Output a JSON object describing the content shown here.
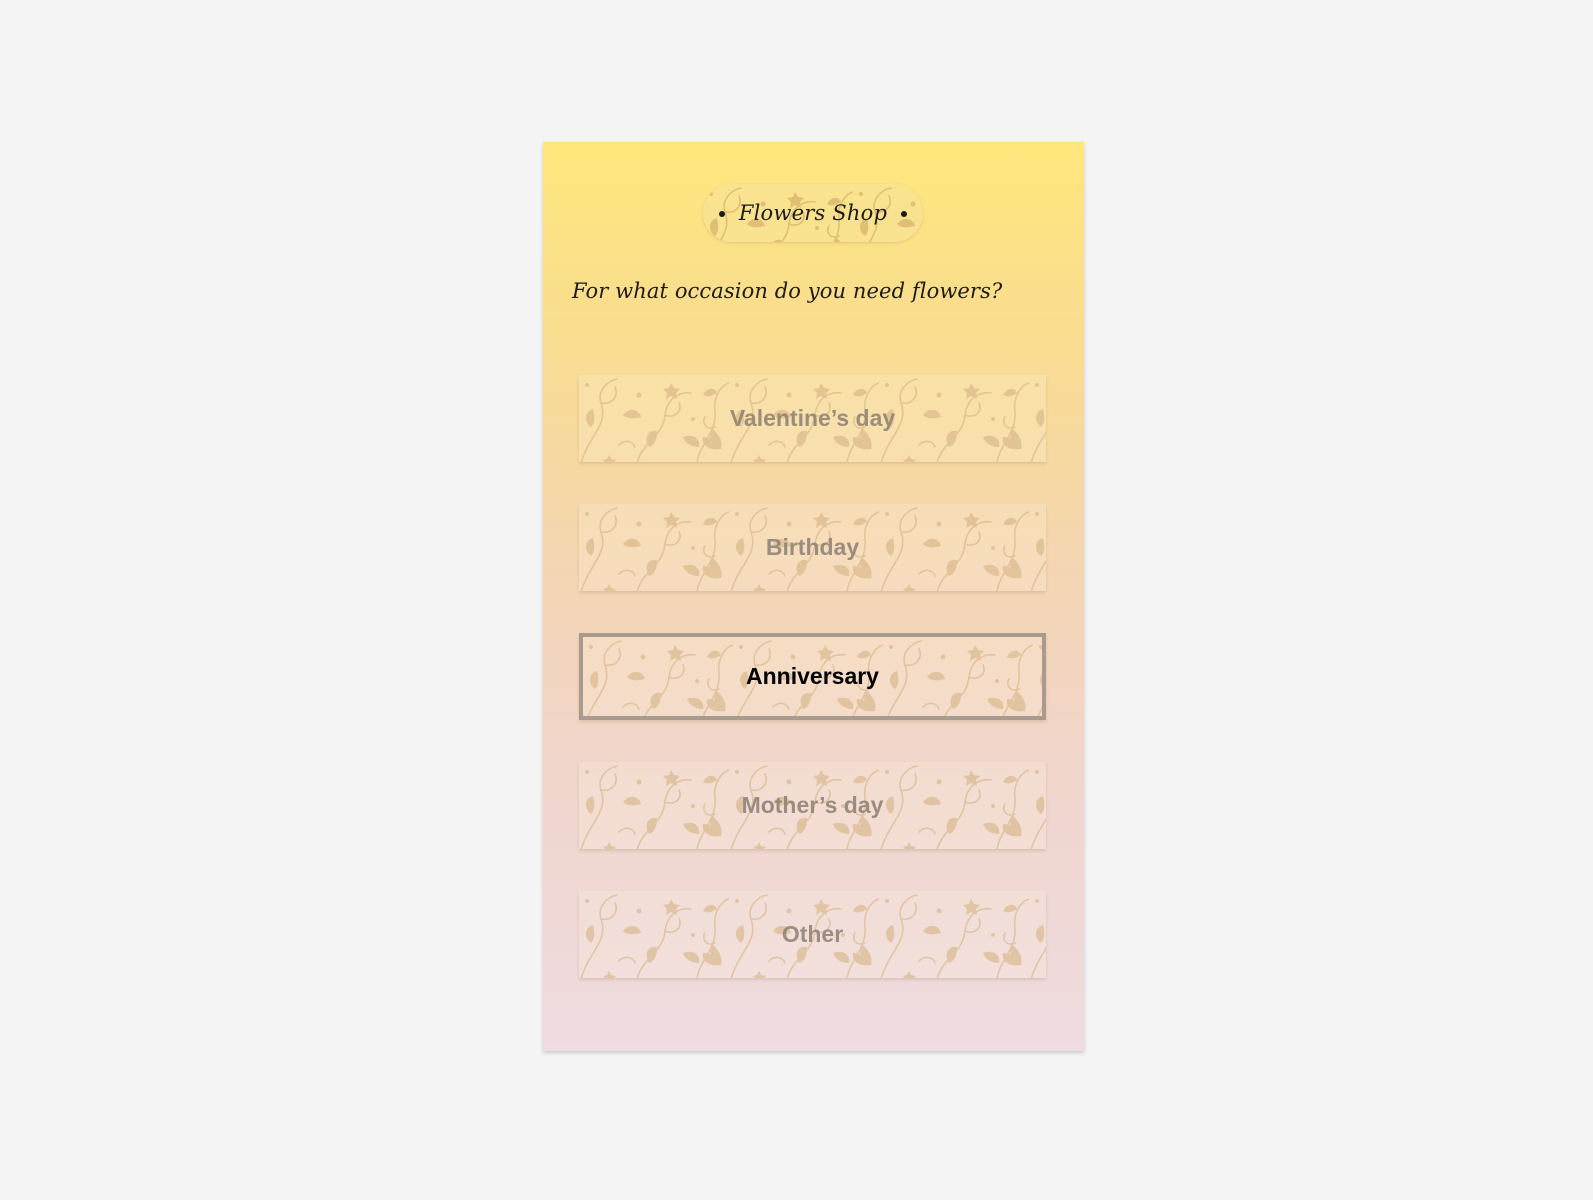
{
  "header": {
    "title": "Flowers Shop"
  },
  "question": "For what occasion do you need flowers?",
  "options": [
    {
      "label": "Valentine’s day",
      "selected": false
    },
    {
      "label": "Birthday",
      "selected": false
    },
    {
      "label": "Anniversary",
      "selected": true
    },
    {
      "label": "Mother’s day",
      "selected": false
    },
    {
      "label": "Other",
      "selected": false
    }
  ],
  "colors": {
    "background": "#f4f4f4",
    "gradient_top": "#ffe77c",
    "gradient_bottom": "#efdbe0",
    "pattern": "#c9a06a",
    "selected_border": "#a89a8c"
  },
  "icons": {
    "floral_pattern": "floral-vine-pattern",
    "pill_dot": "bullet-dot-icon"
  }
}
